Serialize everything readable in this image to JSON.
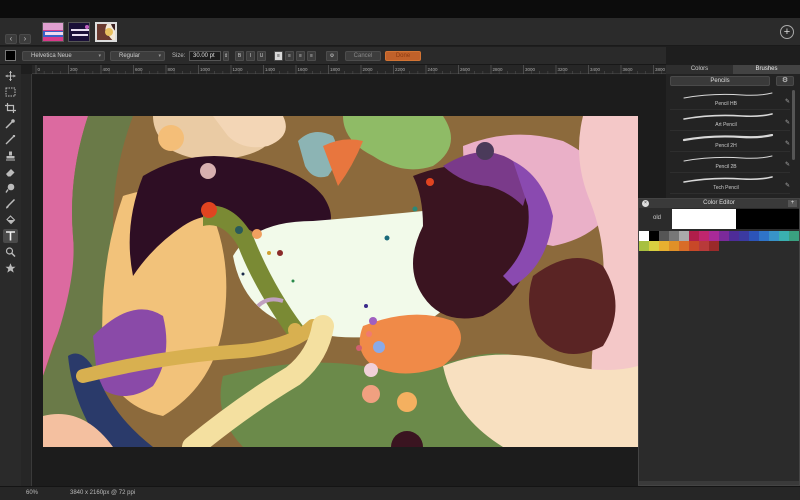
{
  "tabbar": {
    "back_icon": "chevron-left-icon",
    "forward_icon": "chevron-right-icon",
    "back_glyph": "‹",
    "forward_glyph": "›",
    "add_icon": "plus-icon",
    "add_glyph": "+"
  },
  "options": {
    "font_family": "Helvetica Neue",
    "font_style": "Regular",
    "size_label": "Size:",
    "size_value": "30.00 pt",
    "bold": "B",
    "italic": "I",
    "underline": "U",
    "cancel": "Cancel",
    "done": "Done",
    "settings_icon": "gear-icon"
  },
  "ruler": {
    "ticks": [
      "0",
      "200",
      "400",
      "600",
      "800",
      "1000",
      "1200",
      "1400",
      "1600",
      "1800",
      "2000",
      "2200",
      "2400",
      "2600",
      "2800",
      "3000",
      "3200",
      "3400",
      "3600",
      "3800"
    ]
  },
  "tools": [
    {
      "name": "move-tool-icon"
    },
    {
      "name": "marquee-tool-icon"
    },
    {
      "name": "crop-tool-icon"
    },
    {
      "name": "eyedropper-tool-icon"
    },
    {
      "name": "line-tool-icon"
    },
    {
      "name": "stamp-tool-icon"
    },
    {
      "name": "eraser-tool-icon"
    },
    {
      "name": "smudge-tool-icon"
    },
    {
      "name": "brush-tool-icon"
    },
    {
      "name": "fill-tool-icon"
    },
    {
      "name": "text-tool-icon",
      "active": true
    },
    {
      "name": "zoom-tool-icon"
    },
    {
      "name": "favorite-tool-icon"
    }
  ],
  "status": {
    "zoom": "60%",
    "dimensions": "3840 x 2160px @ 72 ppi"
  },
  "panel": {
    "tab_colors": "Colors",
    "tab_brushes": "Brushes",
    "brush_set": "Pencils",
    "brushes": [
      {
        "name": "Pencil HB"
      },
      {
        "name": "Art Pencil"
      },
      {
        "name": "Pencil 2H"
      },
      {
        "name": "Pencil 2B"
      },
      {
        "name": "Tech Pencil"
      }
    ]
  },
  "color_editor": {
    "title": "Color Editor",
    "old_label": "old",
    "old_color": "#ffffff",
    "new_color": "#000000",
    "palette_row1": [
      "#ffffff",
      "#000000",
      "#555555",
      "#777777",
      "#aaaaaa",
      "#b01e4a",
      "#c0266e",
      "#a82a98",
      "#7b2a9a",
      "#4e2c98",
      "#3b3aa0",
      "#2c54b8",
      "#2f74c8",
      "#3893c8",
      "#3ab0b0",
      "#3aa080"
    ],
    "palette_row2": [
      "#a8c040",
      "#d8d040",
      "#e8b030",
      "#e09028",
      "#d86c28",
      "#c84828",
      "#b83a3a",
      "#9a2a2a"
    ]
  }
}
